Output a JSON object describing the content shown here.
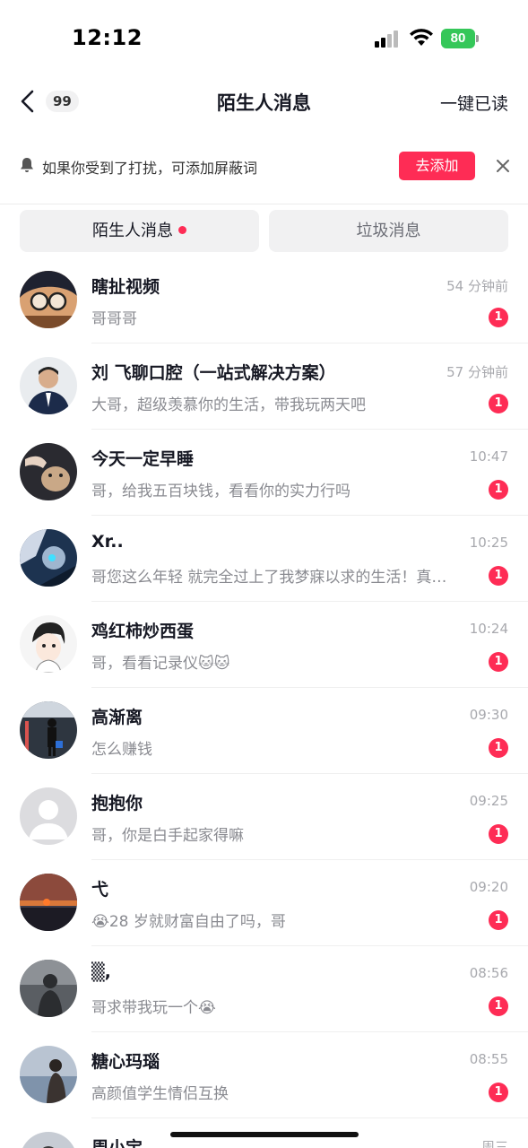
{
  "status_bar": {
    "time": "12:12",
    "battery": "80"
  },
  "nav": {
    "unread_count": "99",
    "title": "陌生人消息",
    "read_all": "一键已读"
  },
  "notice": {
    "text": "如果你受到了打扰，可添加屏蔽词",
    "add_label": "去添加"
  },
  "tabs": {
    "strangers": "陌生人消息",
    "spam": "垃圾消息"
  },
  "accent_color": "#fe2c55",
  "messages": [
    {
      "name": "瞎扯视频",
      "preview": "哥哥哥",
      "time": "54 分钟前",
      "badge": "1"
    },
    {
      "name": "刘 飞聊口腔（一站式解决方案）",
      "preview": "大哥，超级羡慕你的生活，带我玩两天吧",
      "time": "57 分钟前",
      "badge": "1"
    },
    {
      "name": "今天一定早睡",
      "preview": "哥，给我五百块钱，看看你的实力行吗",
      "time": "10:47",
      "badge": "1"
    },
    {
      "name": "Xr..",
      "preview": "哥您这么年轻 就完全过上了我梦寐以求的生活！真…",
      "time": "10:25",
      "badge": "1"
    },
    {
      "name": "鸡红柿炒西蛋",
      "preview": "哥，看看记录仪🐱🐱",
      "time": "10:24",
      "badge": "1"
    },
    {
      "name": "高渐离",
      "preview": "怎么赚钱",
      "time": "09:30",
      "badge": "1"
    },
    {
      "name": "抱抱你",
      "preview": "哥，你是白手起家得嘛",
      "time": "09:25",
      "badge": "1"
    },
    {
      "name": "弋",
      "preview": "😭28 岁就财富自由了吗，哥",
      "time": "09:20",
      "badge": "1"
    },
    {
      "name": "▒,",
      "preview": "哥求带我玩一个😭",
      "time": "08:56",
      "badge": "1"
    },
    {
      "name": "糖心玛瑙",
      "preview": "高颜值学生情侣互换",
      "time": "08:55",
      "badge": "1"
    },
    {
      "name": "周小宝",
      "preview": "",
      "time": "周三",
      "badge": ""
    }
  ]
}
